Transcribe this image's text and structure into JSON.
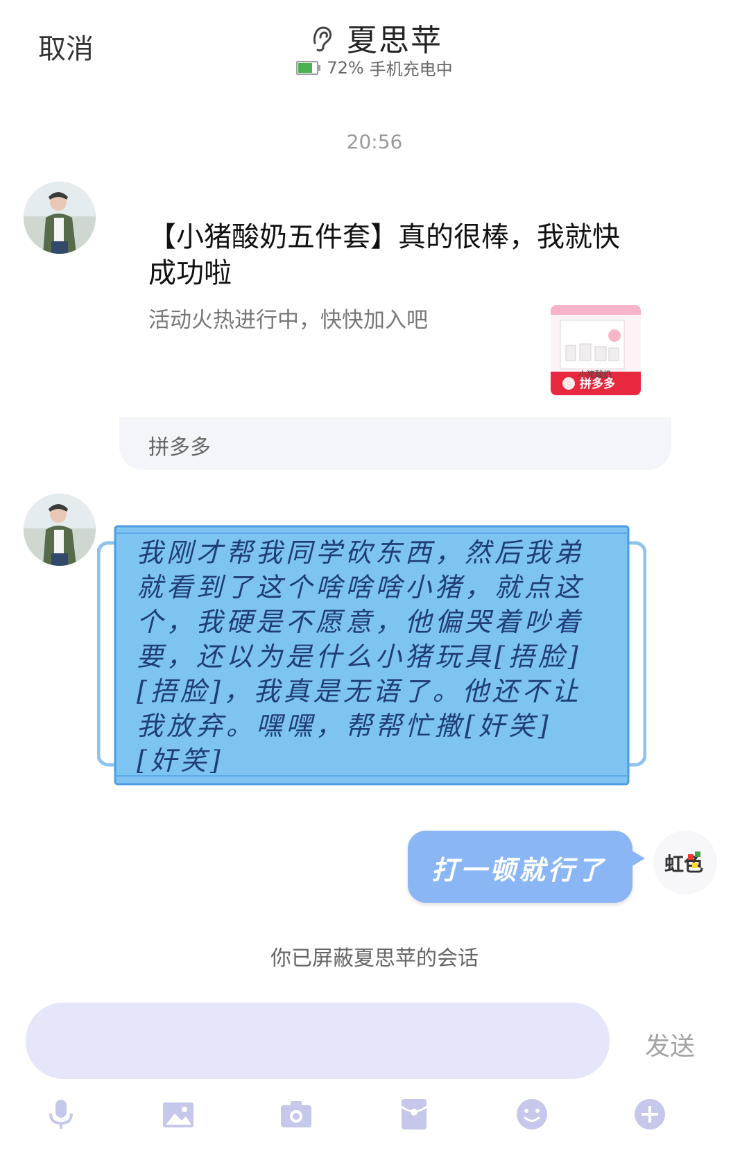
{
  "header": {
    "cancel": "取消",
    "contact_name": "夏思苹",
    "battery_percent": "72%",
    "status_text": "手机充电中"
  },
  "chat": {
    "time": "20:56",
    "share_card": {
      "title": "【小猪酸奶五件套】真的很棒，我就快成功啦",
      "subtitle": "活动火热进行中，快快加入吧",
      "source": "拼多多",
      "image_brand_text": "拼多多",
      "image_product_text": "小猪酸奶"
    },
    "incoming_message": "我刚才帮我同学砍东西，然后我弟就看到了这个啥啥啥小猪，就点这个，我硬是不愿意，他偏哭着吵着要，还以为是什么小猪玩具[捂脸][捂脸]，我真是无语了。他还不让我放弃。嘿嘿，帮帮忙撒[奸笑][奸笑]",
    "outgoing_message": "打一顿就行了",
    "my_avatar_text": "虹色",
    "blocked_notice": "你已屏蔽夏思苹的会话"
  },
  "input": {
    "value": "",
    "send_label": "发送"
  },
  "toolbar": {
    "icons": [
      "microphone-icon",
      "image-icon",
      "camera-icon",
      "red-packet-icon",
      "emoji-icon",
      "plus-icon"
    ]
  },
  "colors": {
    "outgoing_bubble": "#8ab6f6",
    "input_background": "#e6e6fa",
    "mask_blue": "#7ec4f0",
    "toolbar_icon": "#c5c8ea"
  }
}
